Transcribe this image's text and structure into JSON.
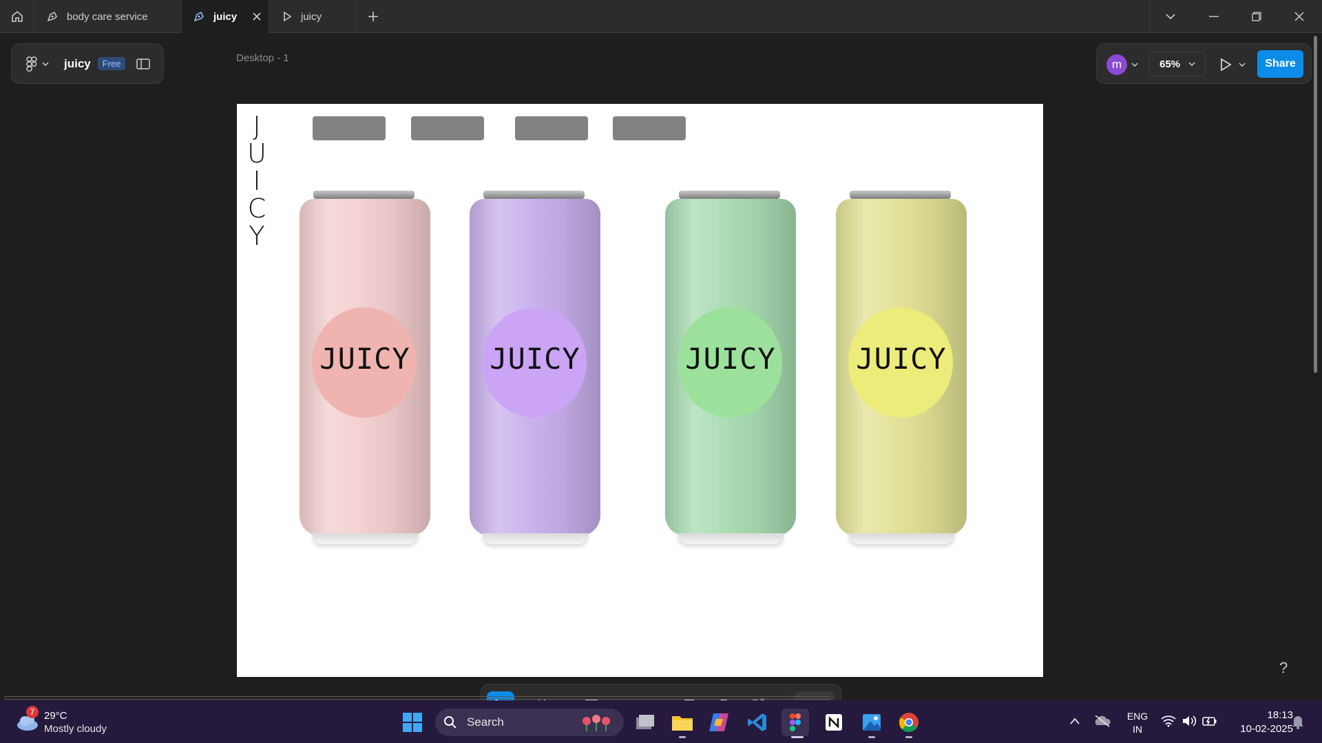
{
  "tabs": [
    {
      "label": "body care service",
      "icon": "figma-pen-icon"
    },
    {
      "label": "juicy",
      "icon": "figma-pen-icon",
      "active": true
    },
    {
      "label": "juicy",
      "icon": "play-icon"
    }
  ],
  "file": {
    "name": "juicy",
    "plan_badge": "Free"
  },
  "frame_label": "Desktop - 1",
  "header_right": {
    "avatar_initial": "m",
    "zoom": "65%",
    "share_label": "Share"
  },
  "design": {
    "vertical_title": [
      "J",
      "U",
      "I",
      "C",
      "Y"
    ],
    "cans": [
      {
        "label": "JUICY",
        "body_color": "#f4cfd0",
        "circle_color": "#efb3b0"
      },
      {
        "label": "JUICY",
        "body_color": "#c8b0ec",
        "circle_color": "#cba4f5"
      },
      {
        "label": "JUICY",
        "body_color": "#a8dcb2",
        "circle_color": "#9be19c"
      },
      {
        "label": "JUICY",
        "body_color": "#e2e296",
        "circle_color": "#ecec7a"
      }
    ]
  },
  "help_label": "?",
  "taskbar": {
    "weather_temp": "29°C",
    "weather_desc": "Mostly cloudy",
    "weather_badge": "7",
    "search_label": "Search",
    "lang_line1": "ENG",
    "lang_line2": "IN",
    "time": "18:13",
    "date": "10-02-2025"
  }
}
